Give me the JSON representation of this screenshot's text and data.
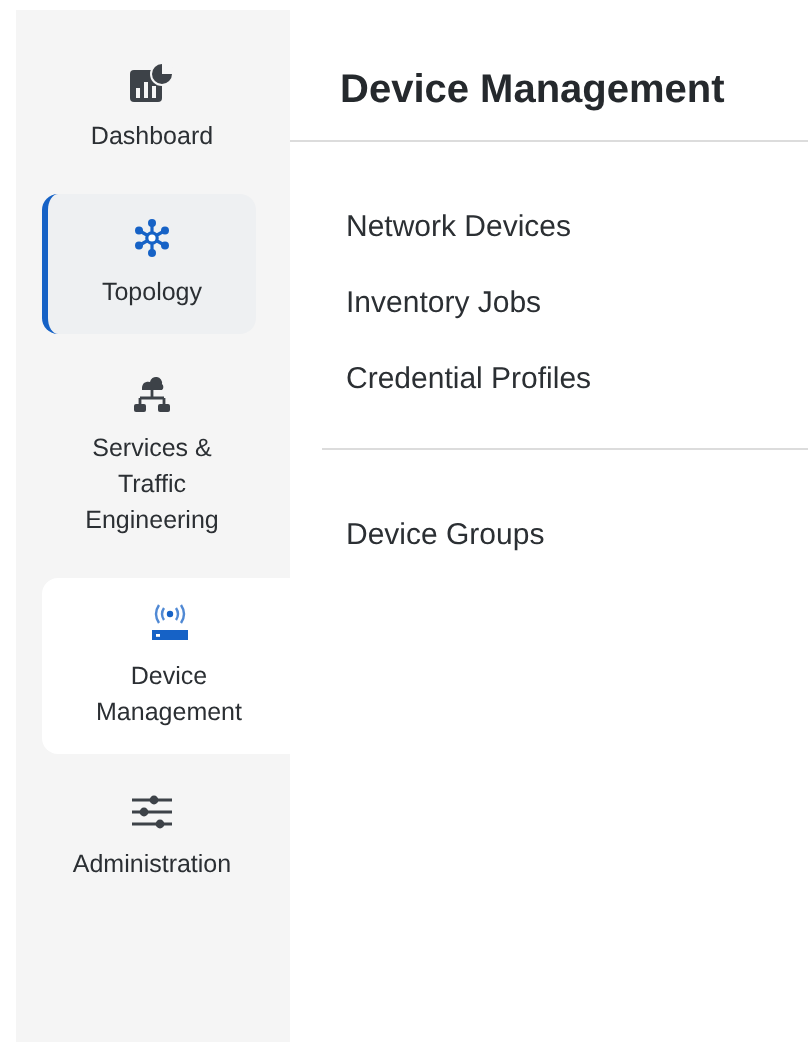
{
  "sidebar": {
    "items": [
      {
        "label": "Dashboard",
        "selected": false,
        "open": false
      },
      {
        "label": "Topology",
        "selected": true,
        "open": false
      },
      {
        "label": "Services & Traffic Engineering",
        "selected": false,
        "open": false
      },
      {
        "label": "Device Management",
        "selected": false,
        "open": true
      },
      {
        "label": "Administration",
        "selected": false,
        "open": false
      }
    ]
  },
  "flyout": {
    "title": "Device Management",
    "groups": [
      {
        "items": [
          "Network Devices",
          "Inventory Jobs",
          "Credential Profiles"
        ]
      },
      {
        "items": [
          "Device Groups"
        ]
      }
    ]
  }
}
